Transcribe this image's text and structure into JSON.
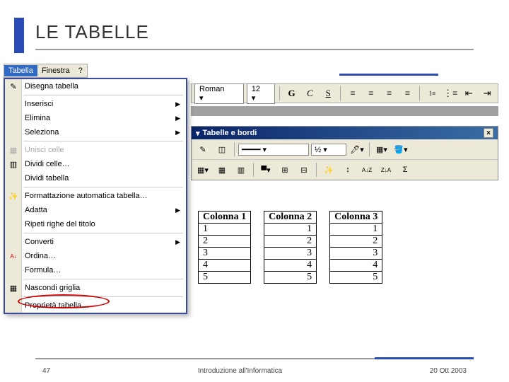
{
  "slide": {
    "title": "LE TABELLE",
    "page_number": "47",
    "center_text": "Introduzione all'Informatica",
    "date": "20 Ott 2003"
  },
  "menubar": {
    "items": [
      {
        "label": "Tabella",
        "active": true
      },
      {
        "label": "Finestra",
        "active": false
      },
      {
        "label": "?",
        "active": false
      }
    ]
  },
  "dropdown": {
    "items": [
      {
        "label": "Disegna tabella",
        "icon": "pencil-icon",
        "submenu": false
      },
      {
        "sep": true
      },
      {
        "label": "Inserisci",
        "submenu": true
      },
      {
        "label": "Elimina",
        "submenu": true
      },
      {
        "label": "Seleziona",
        "submenu": true
      },
      {
        "sep": true
      },
      {
        "label": "Unisci celle",
        "icon": "merge-cells-icon",
        "disabled": true
      },
      {
        "label": "Dividi celle…",
        "icon": "split-cells-icon"
      },
      {
        "label": "Dividi tabella"
      },
      {
        "sep": true
      },
      {
        "label": "Formattazione automatica tabella…",
        "icon": "autoformat-icon"
      },
      {
        "label": "Adatta",
        "submenu": true
      },
      {
        "label": "Ripeti righe del titolo"
      },
      {
        "sep": true
      },
      {
        "label": "Converti",
        "submenu": true
      },
      {
        "label": "Ordina…",
        "icon": "sort-az-icon"
      },
      {
        "label": "Formula…"
      },
      {
        "sep": true
      },
      {
        "label": "Nascondi griglia",
        "icon": "hide-grid-icon"
      },
      {
        "sep": true
      },
      {
        "label": "Proprietà tabella…",
        "highlight": true
      }
    ]
  },
  "toolbar1": {
    "font": "Roman",
    "size": "12",
    "buttons": {
      "bold": "G",
      "italic": "C",
      "underline": "S"
    }
  },
  "tbpanel": {
    "title": "Tabelle e bordi",
    "row1": {
      "line_weight": "½",
      "dropdown_arrow": "▾"
    },
    "row2": {
      "sort_az": "A↓Z",
      "sort_za": "Z↓A",
      "sigma": "Σ"
    }
  },
  "tables": {
    "headers": [
      "Colonna 1",
      "Colonna 2",
      "Colonna 3"
    ],
    "rows": [
      [
        "1",
        "1",
        "1"
      ],
      [
        "2",
        "2",
        "2"
      ],
      [
        "3",
        "3",
        "3"
      ],
      [
        "4",
        "4",
        "4"
      ],
      [
        "5",
        "5",
        "5"
      ]
    ]
  }
}
